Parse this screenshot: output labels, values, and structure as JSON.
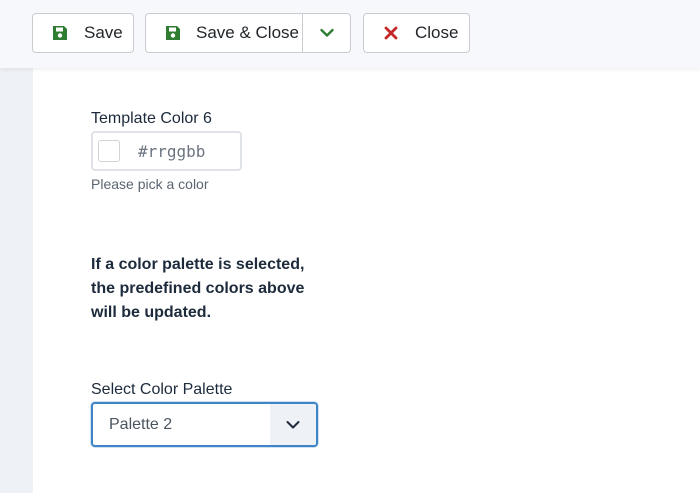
{
  "toolbar": {
    "save_label": "Save",
    "save_close_label": "Save & Close",
    "close_label": "Close",
    "save_icon": "floppy-disk-icon",
    "close_icon": "x-icon",
    "dropdown_icon": "chevron-down-icon",
    "accent_green": "#2f7d32",
    "accent_red": "#c62828"
  },
  "form": {
    "template_color": {
      "label": "Template Color 6",
      "placeholder": "#rrggbb",
      "hint": "Please pick a color"
    },
    "note": "If a color palette is selected, the predefined colors above will be updated.",
    "palette": {
      "label": "Select Color Palette",
      "selected": "Palette 2",
      "focus_color": "#3d85c6"
    }
  }
}
